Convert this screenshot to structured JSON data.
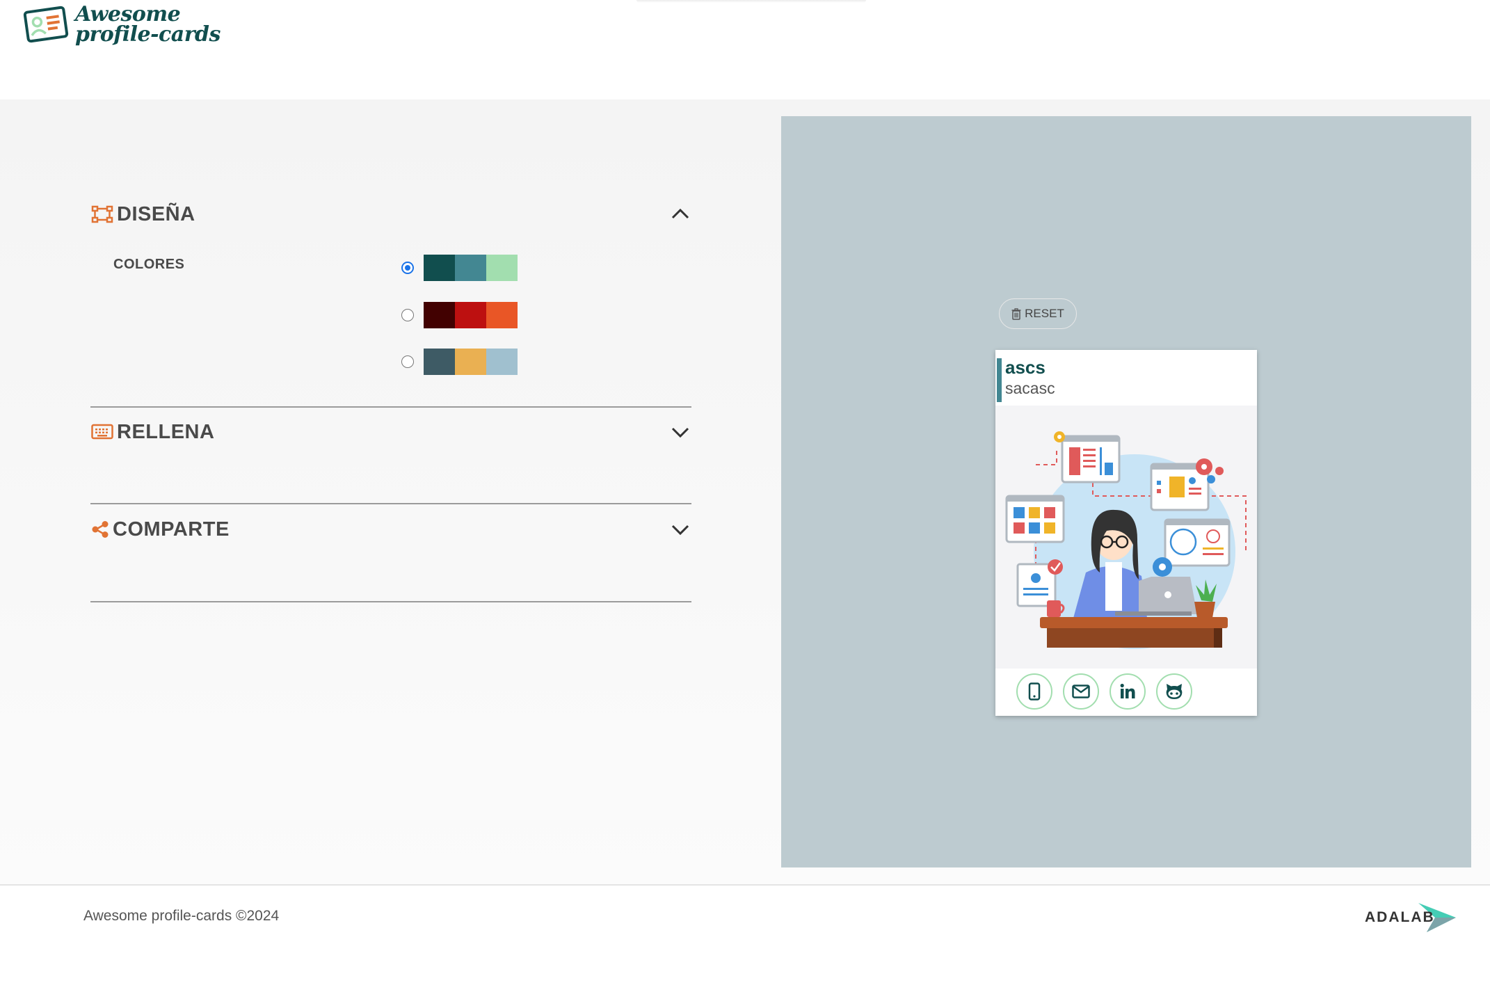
{
  "header": {
    "logo_line1": "Awesome",
    "logo_line2": "profile-cards"
  },
  "sections": {
    "design": {
      "title": "DISEÑA",
      "colors_label": "COLORES",
      "palettes": [
        {
          "selected": true,
          "colors": [
            "#114e4e",
            "#438792",
            "#a2deaf"
          ]
        },
        {
          "selected": false,
          "colors": [
            "#420101",
            "#bd1010",
            "#e95626"
          ]
        },
        {
          "selected": false,
          "colors": [
            "#3e5b65",
            "#eab052",
            "#a0c0cf"
          ]
        }
      ]
    },
    "fill": {
      "title": "RELLENA"
    },
    "share": {
      "title": "COMPARTE"
    }
  },
  "preview": {
    "reset_label": "RESET",
    "card": {
      "name": "ascs",
      "job": "sacasc",
      "icons": [
        "mobile-icon",
        "envelope-icon",
        "linkedin-icon",
        "github-icon"
      ]
    }
  },
  "footer": {
    "copyright": "Awesome profile-cards ©2024",
    "brand": "ADALAB"
  },
  "colors": {
    "accent": "#e17334",
    "dark_green": "#114e4e",
    "mid_teal": "#438792",
    "light_green": "#a2deaf",
    "preview_bg": "#bdcbd0"
  }
}
